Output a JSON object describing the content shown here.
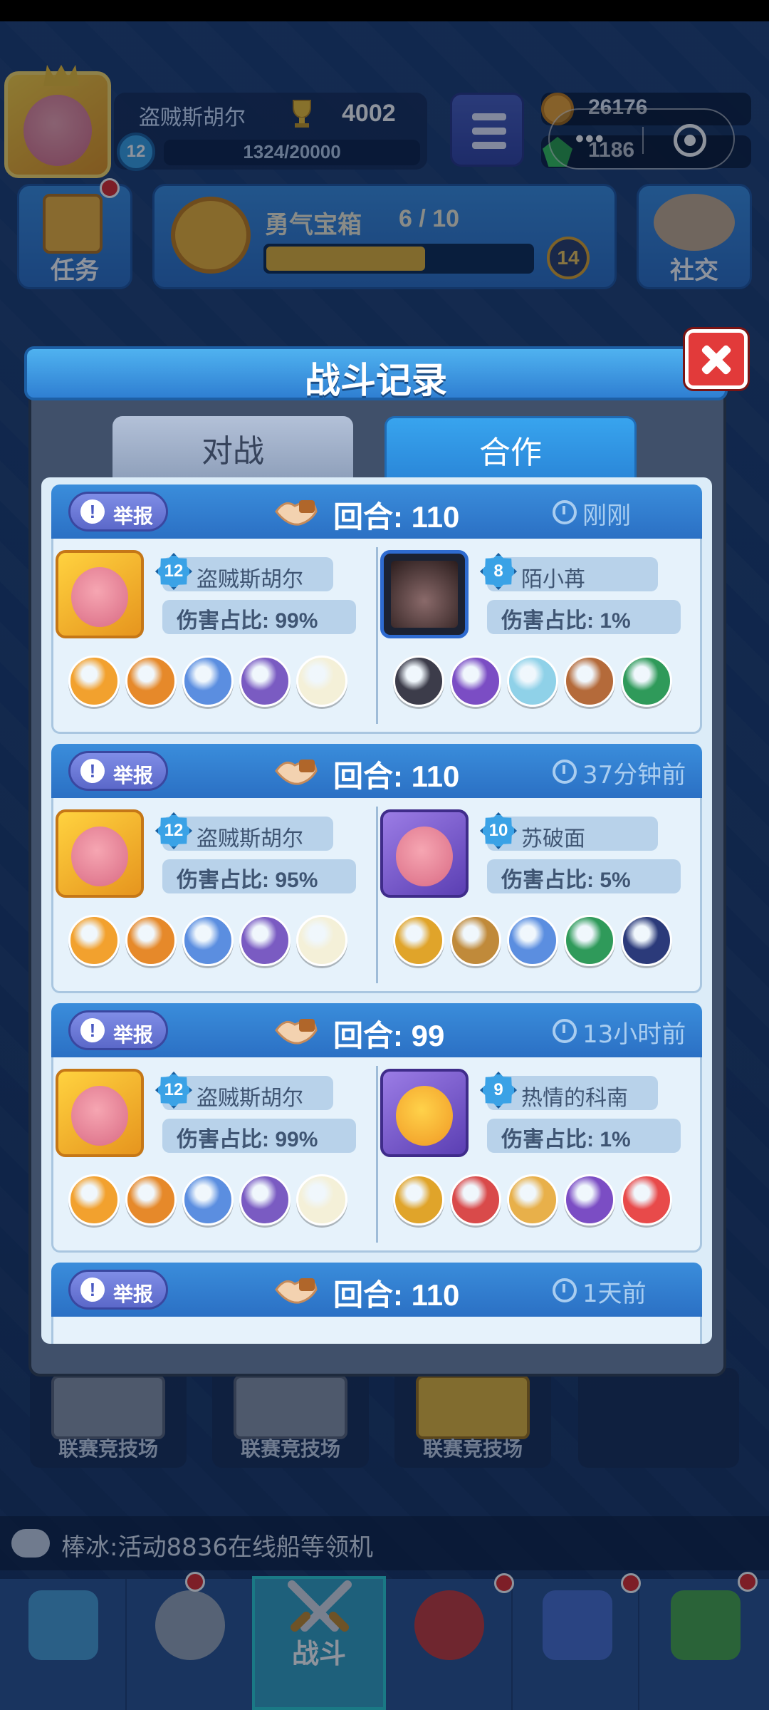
{
  "top": {
    "player_name": "盗贼斯胡尔",
    "trophies": "4002",
    "level": "12",
    "xp": "1324/20000",
    "coins": "26176",
    "gems": "1186",
    "capsule_more": "•••"
  },
  "row2": {
    "task_label": "任务",
    "chest_title": "勇气宝箱",
    "chest_count": "6 / 10",
    "chest_progress_fraction": 0.6,
    "chest_level": "14",
    "social_label": "社交"
  },
  "modal": {
    "title": "战斗记录",
    "tabs": [
      "对战",
      "合作"
    ],
    "active_tab": "合作",
    "records": [
      {
        "report": "举报",
        "round": "回合: 110",
        "time": "刚刚",
        "left": {
          "level": "12",
          "name": "盗贼斯胡尔",
          "damage": "伤害占比: 99%",
          "heroes": [
            "#f2a12e",
            "#e6892a",
            "#5b8ee0",
            "#7a5bc2",
            "#f4f0d8"
          ]
        },
        "right": {
          "level": "8",
          "name": "陌小苒",
          "damage": "伤害占比: 1%",
          "heroes": [
            "#3c3c4a",
            "#7b4dc4",
            "#8fd1e8",
            "#b46a3a",
            "#2f9a5a"
          ]
        }
      },
      {
        "report": "举报",
        "round": "回合: 110",
        "time": "37分钟前",
        "left": {
          "level": "12",
          "name": "盗贼斯胡尔",
          "damage": "伤害占比: 95%",
          "heroes": [
            "#f2a12e",
            "#e6892a",
            "#5b8ee0",
            "#7a5bc2",
            "#f4f0d8"
          ]
        },
        "right": {
          "level": "10",
          "name": "苏破面",
          "damage": "伤害占比: 5%",
          "heroes": [
            "#e0a42a",
            "#c08a3a",
            "#5b8ee0",
            "#2f9a5a",
            "#2b3a7a"
          ]
        }
      },
      {
        "report": "举报",
        "round": "回合: 99",
        "time": "13小时前",
        "left": {
          "level": "12",
          "name": "盗贼斯胡尔",
          "damage": "伤害占比: 99%",
          "heroes": [
            "#f2a12e",
            "#e6892a",
            "#5b8ee0",
            "#7a5bc2",
            "#f4f0d8"
          ]
        },
        "right": {
          "level": "9",
          "name": "热情的科南",
          "damage": "伤害占比: 1%",
          "heroes": [
            "#e0a42a",
            "#d94a4a",
            "#e8b04a",
            "#7b4dc4",
            "#e84a4a"
          ]
        }
      },
      {
        "report": "举报",
        "round": "回合: 110",
        "time": "1天前"
      }
    ]
  },
  "league": [
    "联赛竞技场",
    "联赛竞技场",
    "联赛竞技场"
  ],
  "ticker": "棒冰:活动8836在线船等领机",
  "nav": {
    "battle_label": "战斗"
  },
  "colors": {
    "header_blue": "#2f7fd2",
    "close_red": "#e23a3a",
    "badge_blue": "#3aa2e6"
  }
}
